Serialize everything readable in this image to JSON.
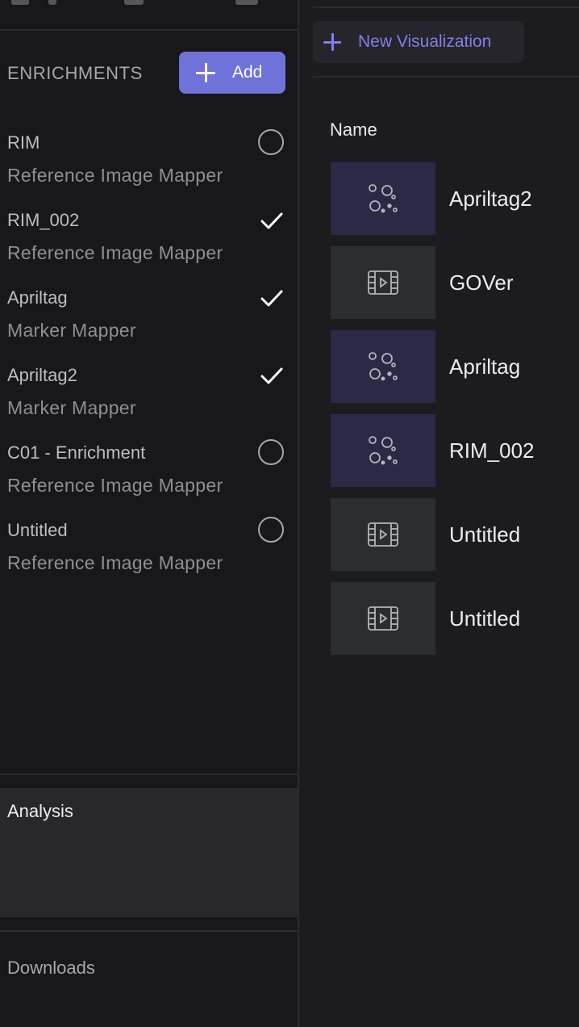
{
  "enrichments": {
    "title": "ENRICHMENTS",
    "add_label": "Add",
    "items": [
      {
        "name": "RIM",
        "type": "Reference Image Mapper",
        "status": "pending"
      },
      {
        "name": "RIM_002",
        "type": "Reference Image Mapper",
        "status": "done"
      },
      {
        "name": "Apriltag",
        "type": "Marker Mapper",
        "status": "done"
      },
      {
        "name": "Apriltag2",
        "type": "Marker Mapper",
        "status": "done"
      },
      {
        "name": "C01 - Enrichment",
        "type": "Reference Image Mapper",
        "status": "pending"
      },
      {
        "name": "Untitled",
        "type": "Reference Image Mapper",
        "status": "pending"
      }
    ]
  },
  "sections": {
    "analysis": "Analysis",
    "downloads": "Downloads"
  },
  "visualizations": {
    "new_label": "New Visualization",
    "column_name": "Name",
    "items": [
      {
        "name": "Apriltag2",
        "icon": "marker-mapper-icon"
      },
      {
        "name": "GOVer",
        "icon": "video-icon"
      },
      {
        "name": "Apriltag",
        "icon": "marker-mapper-icon"
      },
      {
        "name": "RIM_002",
        "icon": "marker-mapper-icon"
      },
      {
        "name": "Untitled",
        "icon": "video-icon"
      },
      {
        "name": "Untitled",
        "icon": "video-icon"
      }
    ]
  },
  "colors": {
    "accent": "#6f72d9",
    "accent_text": "#7d80e6",
    "background": "#1c1c1e",
    "panel": "#18181a"
  }
}
